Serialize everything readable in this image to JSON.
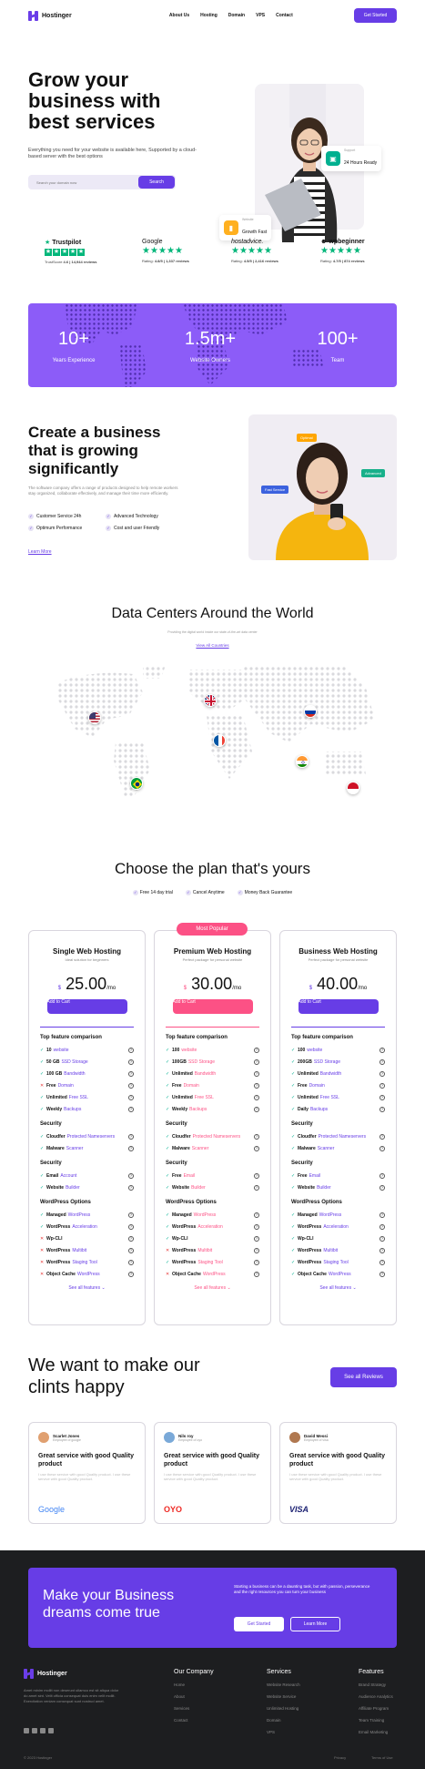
{
  "brand": {
    "name": "Hostinger",
    "accent": "#673de6",
    "pink": "#fc5185",
    "green": "#00b67a"
  },
  "nav": {
    "links": [
      "About Us",
      "Hosting",
      "Domain",
      "VPS",
      "Contact"
    ],
    "cta": "Get Started"
  },
  "hero": {
    "title": "Grow your business with best services",
    "subtitle": "Everything you need for your website is available here, Supported by a cloud-based server with the best options",
    "search_placeholder": "Search your domain now",
    "search_button": "Search",
    "card_support": {
      "small": "Support",
      "label": "24 Hours Ready"
    },
    "card_speed": {
      "small": "Website",
      "label": "Growth Fast"
    }
  },
  "reviews": [
    {
      "name": "Trustpilot",
      "meta_a": "TrustScore",
      "meta_b": "4.6",
      "meta_c": "| 14,944 reviews"
    },
    {
      "name": "Google",
      "meta_a": "Rating:",
      "meta_b": "4.8/5",
      "meta_c": "| 1,337 reviews"
    },
    {
      "name": "hostadvice.",
      "meta_a": "Rating:",
      "meta_b": "4.5/5",
      "meta_c": "| 2,416 reviews"
    },
    {
      "name": "wpbeginner",
      "meta_a": "Rating:",
      "meta_b": "4.7/5",
      "meta_c": "| 874 reviews"
    }
  ],
  "stats": [
    {
      "value": "10+",
      "label": "Years Experience"
    },
    {
      "value": "1.5m+",
      "label": "Website Owners"
    },
    {
      "value": "100+",
      "label": "Team"
    }
  ],
  "growth": {
    "title": "Create a business that is growing significantly",
    "desc": "The software company offers a range of products designed to help remote workers stay organized, collaborate effectively, and manage their time more efficiently.",
    "features": [
      "Customer Service 24h",
      "Advanced Technology",
      "Optimum Performance",
      "Cost and user Friendly"
    ],
    "learn": "Learn More",
    "tags": [
      "Optimal",
      "Fast Service",
      "Advanced"
    ]
  },
  "datacenters": {
    "title": "Data Centers Around the World",
    "sub": "Providing the digital world inside our state-of-the-art data center",
    "link": "View All Countries"
  },
  "pricing": {
    "title": "Choose the plan that's yours",
    "perks": [
      "Free 14 day trial",
      "Cancel Anytime",
      "Money Back Guarantee"
    ],
    "popular": "Most Popular",
    "cart": "Add to Cart",
    "seeall": "See all features",
    "section_titles": [
      "Top feature comparison",
      "Security",
      "Security",
      "WordPress Options"
    ],
    "plans": [
      {
        "name": "Single Web Hosting",
        "desc": "Ideal solution for beginners",
        "currency": "$",
        "price": "25.00",
        "per": "/mo",
        "top": [
          [
            "✓",
            "10",
            "website"
          ],
          [
            "✓",
            "50 GB",
            "SSD Storage"
          ],
          [
            "✓",
            "100 GB",
            "Bandwidth"
          ],
          [
            "✕",
            "Free",
            "Domain"
          ],
          [
            "✓",
            "Unlimited",
            "Free SSL"
          ],
          [
            "✓",
            "Weekly",
            "Backups"
          ]
        ],
        "sec1": [
          [
            "✓",
            "Cloudfer",
            "Protected Nameservers"
          ],
          [
            "✓",
            "Malware",
            "Scanner"
          ]
        ],
        "sec2": [
          [
            "✓",
            "Email",
            "Account"
          ],
          [
            "✓",
            "Website",
            "Builder"
          ]
        ],
        "wp": [
          [
            "✓",
            "Managed",
            "WordPress"
          ],
          [
            "✓",
            "WordPress",
            "Acceleration"
          ],
          [
            "✕",
            "Wp-CLI",
            ""
          ],
          [
            "✕",
            "WordPress",
            "Multibit"
          ],
          [
            "✕",
            "WordPress",
            "Staging Tool"
          ],
          [
            "✕",
            "Object Cache",
            "WordPress"
          ]
        ]
      },
      {
        "name": "Premium Web Hosting",
        "desc": "Perfect package for personal website",
        "currency": "$",
        "price": "30.00",
        "per": "/mo",
        "top": [
          [
            "✓",
            "100",
            "website"
          ],
          [
            "✓",
            "100GB",
            "SSD Storage"
          ],
          [
            "✓",
            "Unlimited",
            "Bandwidth"
          ],
          [
            "✓",
            "Free",
            "Domain"
          ],
          [
            "✓",
            "Unlimited",
            "Free SSL"
          ],
          [
            "✓",
            "Weekly",
            "Backups"
          ]
        ],
        "sec1": [
          [
            "✓",
            "Cloudfer",
            "Protected Nameservers"
          ],
          [
            "✓",
            "Malware",
            "Scanner"
          ]
        ],
        "sec2": [
          [
            "✓",
            "Free",
            "Email"
          ],
          [
            "✓",
            "Website",
            "Builder"
          ]
        ],
        "wp": [
          [
            "✓",
            "Managed",
            "WordPress"
          ],
          [
            "✓",
            "WordPress",
            "Acceleration"
          ],
          [
            "✓",
            "Wp-CLI",
            ""
          ],
          [
            "✕",
            "WordPress",
            "Multibit"
          ],
          [
            "✓",
            "WordPress",
            "Staging Tool"
          ],
          [
            "✕",
            "Object Cache",
            "WordPress"
          ]
        ]
      },
      {
        "name": "Business Web Hosting",
        "desc": "Perfect package for personal website",
        "currency": "$",
        "price": "40.00",
        "per": "/mo",
        "top": [
          [
            "✓",
            "100",
            "website"
          ],
          [
            "✓",
            "200GB",
            "SSD Storage"
          ],
          [
            "✓",
            "Unlimited",
            "Bandwidth"
          ],
          [
            "✓",
            "Free",
            "Domain"
          ],
          [
            "✓",
            "Unlimited",
            "Free SSL"
          ],
          [
            "✓",
            "Daily",
            "Backups"
          ]
        ],
        "sec1": [
          [
            "✓",
            "Cloudfer",
            "Protected Nameservers"
          ],
          [
            "✓",
            "Malware",
            "Scanner"
          ]
        ],
        "sec2": [
          [
            "✓",
            "Free",
            "Email"
          ],
          [
            "✓",
            "Website",
            "Builder"
          ]
        ],
        "wp": [
          [
            "✓",
            "Managed",
            "WordPress"
          ],
          [
            "✓",
            "WordPress",
            "Acceleration"
          ],
          [
            "✓",
            "Wp-CLI",
            ""
          ],
          [
            "✓",
            "WordPress",
            "Multibit"
          ],
          [
            "✓",
            "WordPress",
            "Staging Tool"
          ],
          [
            "✓",
            "Object Cache",
            "WordPress"
          ]
        ]
      }
    ]
  },
  "testimonials": {
    "title": "We want to make our clints happy",
    "button": "See all Reviews",
    "cards": [
      {
        "name": "Scarlet Jones",
        "role": "Employee of google",
        "headline": "Great service with good Quality product",
        "body": "I use these service with good Quality product. I use these service with good Quality product.",
        "brand": "Google"
      },
      {
        "name": "Nils roy",
        "role": "Employee of oyo",
        "headline": "Great service with good Quality product",
        "body": "I use these service with good Quality product. I use these service with good Quality product.",
        "brand": "OYO"
      },
      {
        "name": "David Messi",
        "role": "Employee of visa",
        "headline": "Great service with good Quality product",
        "body": "I use these service with good Quality product. I use these service with good Quality product.",
        "brand": "VISA"
      }
    ]
  },
  "cta": {
    "title": "Make your Business dreams come true",
    "text": "Starting a business can be a daunting task, but with passion, perseverance and the right resources you can turn your business",
    "primary": "Get Started",
    "secondary": "Learn More"
  },
  "footer": {
    "desc": "Amet minim mollit non deserunt ullamco est sit aliqua dolor do amet sint. Velit officia consequat duis enim velit mollit. Exercitation veniam consequat sunt nostrud amet.",
    "cols": [
      {
        "title": "Our Company",
        "links": [
          "Home",
          "About",
          "Services",
          "Contact"
        ]
      },
      {
        "title": "Services",
        "links": [
          "Website Research",
          "Website Service",
          "Unlimited Hosting",
          "Domain",
          "VPS"
        ]
      },
      {
        "title": "Features",
        "links": [
          "Brand Strategy",
          "Audience Analytics",
          "Affiliate Program",
          "Team Training",
          "Email Marketing"
        ]
      }
    ],
    "copyright": "© 2023 Hostinger",
    "privacy": "Privacy",
    "terms": "Terms of Use"
  }
}
